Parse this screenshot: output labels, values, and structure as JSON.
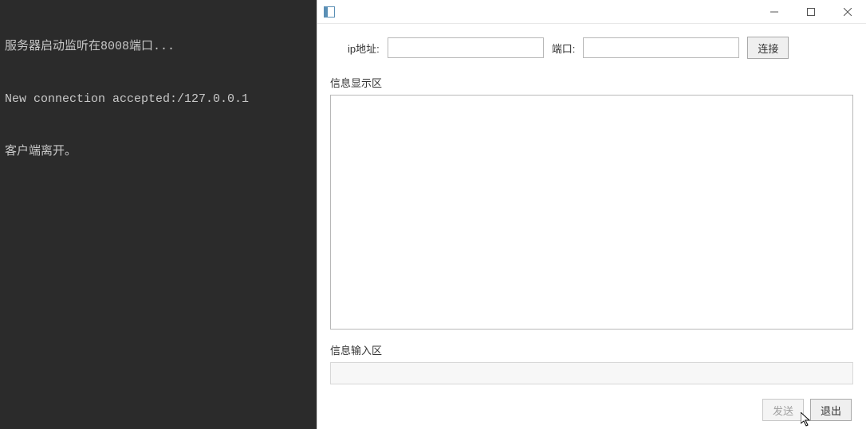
{
  "terminal": {
    "lines": [
      "服务器启动监听在8008端口...",
      "New connection accepted:/127.0.0.1",
      "客户端离开。"
    ]
  },
  "window": {
    "title": "",
    "form": {
      "ip_label": "ip地址:",
      "ip_value": "",
      "port_label": "端口:",
      "port_value": "",
      "connect_label": "连接"
    },
    "display": {
      "label": "信息显示区",
      "content": ""
    },
    "input": {
      "label": "信息输入区",
      "value": ""
    },
    "footer": {
      "send_label": "发送",
      "exit_label": "退出"
    }
  }
}
